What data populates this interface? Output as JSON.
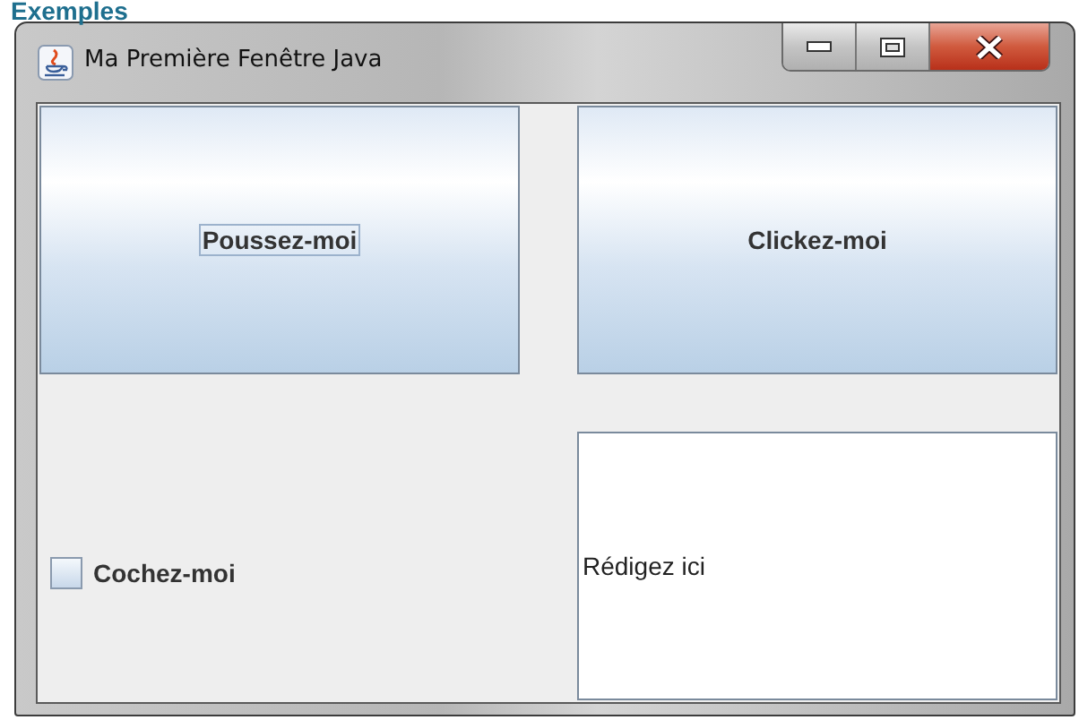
{
  "page_heading": "Exemples",
  "window": {
    "title": "Ma Première Fenêtre Java"
  },
  "buttons": [
    {
      "label": "Poussez-moi",
      "focused": true
    },
    {
      "label": "Clickez-moi",
      "focused": false
    }
  ],
  "checkbox": {
    "label": "Cochez-moi",
    "checked": false
  },
  "text_field": {
    "value": "Rédigez ici"
  }
}
